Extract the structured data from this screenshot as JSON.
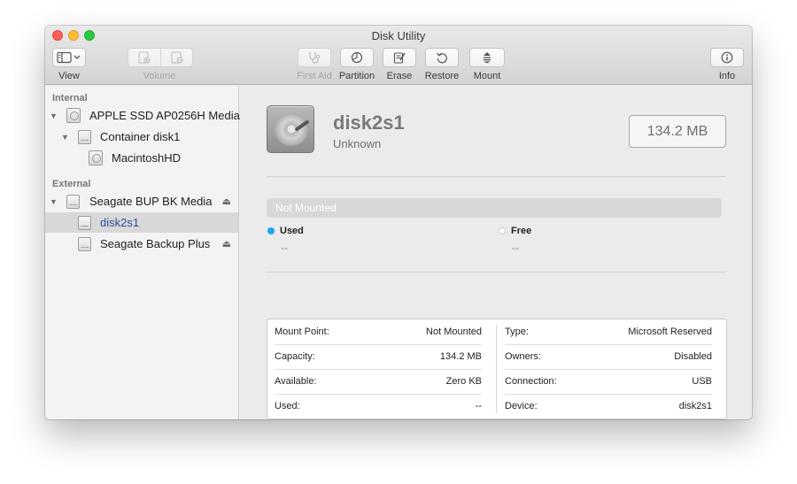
{
  "window": {
    "title": "Disk Utility"
  },
  "toolbar": {
    "view_label": "View",
    "volume_label": "Volume",
    "first_aid_label": "First Aid",
    "partition_label": "Partition",
    "erase_label": "Erase",
    "restore_label": "Restore",
    "mount_label": "Mount",
    "info_label": "Info"
  },
  "sidebar": {
    "internal_header": "Internal",
    "external_header": "External",
    "items": [
      {
        "label": "APPLE SSD AP0256H Media"
      },
      {
        "label": "Container disk1"
      },
      {
        "label": "MacintoshHD"
      },
      {
        "label": "Seagate BUP BK Media"
      },
      {
        "label": "disk2s1"
      },
      {
        "label": "Seagate Backup Plus"
      }
    ]
  },
  "main": {
    "volume_name": "disk2s1",
    "volume_format": "Unknown",
    "capacity_display": "134.2 MB",
    "usage_bar_label": "Not Mounted",
    "used_label": "Used",
    "used_value": "--",
    "free_label": "Free",
    "free_value": "--",
    "used_color": "#1fa6f0",
    "free_color": "#ffffff"
  },
  "info": {
    "left": [
      {
        "key": "Mount Point:",
        "value": "Not Mounted"
      },
      {
        "key": "Capacity:",
        "value": "134.2 MB"
      },
      {
        "key": "Available:",
        "value": "Zero KB"
      },
      {
        "key": "Used:",
        "value": "--"
      }
    ],
    "right": [
      {
        "key": "Type:",
        "value": "Microsoft Reserved"
      },
      {
        "key": "Owners:",
        "value": "Disabled"
      },
      {
        "key": "Connection:",
        "value": "USB"
      },
      {
        "key": "Device:",
        "value": "disk2s1"
      }
    ]
  }
}
